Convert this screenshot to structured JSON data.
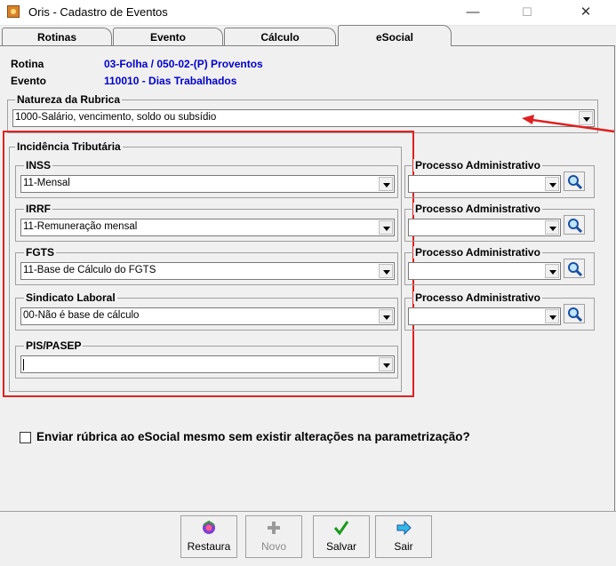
{
  "window": {
    "title": "Oris - Cadastro de Eventos",
    "minimize": "—",
    "maximize": "☐",
    "close": "✕"
  },
  "tabs": [
    {
      "label": "Rotinas"
    },
    {
      "label": "Evento"
    },
    {
      "label": "Cálculo"
    },
    {
      "label": "eSocial"
    }
  ],
  "header": {
    "rotina_label": "Rotina",
    "rotina_value": "03-Folha / 050-02-(P) Proventos",
    "evento_label": "Evento",
    "evento_value": "110010 - Dias Trabalhados"
  },
  "natureza": {
    "label": "Natureza da Rubrica",
    "value": "1000-Salário, vencimento, soldo ou subsídio"
  },
  "incidencia": {
    "label": "Incidência Tributária",
    "inss": {
      "label": "INSS",
      "value": "11-Mensal"
    },
    "irrf": {
      "label": "IRRF",
      "value": "11-Remuneração mensal"
    },
    "fgts": {
      "label": "FGTS",
      "value": "11-Base de Cálculo do FGTS"
    },
    "sindicato": {
      "label": "Sindicato Laboral",
      "value": "00-Não é base de cálculo"
    },
    "pis": {
      "label": "PIS/PASEP",
      "value": ""
    }
  },
  "processo": {
    "label": "Processo Administrativo"
  },
  "checkbox": {
    "label": "Enviar rúbrica ao eSocial mesmo sem existir alterações na parametrização?",
    "checked": false
  },
  "toolbar": {
    "restaura": "Restaura",
    "novo": "Novo",
    "salvar": "Salvar",
    "sair": "Sair"
  },
  "colors": {
    "annotation_red": "#e02020",
    "value_blue": "#0000cc"
  }
}
